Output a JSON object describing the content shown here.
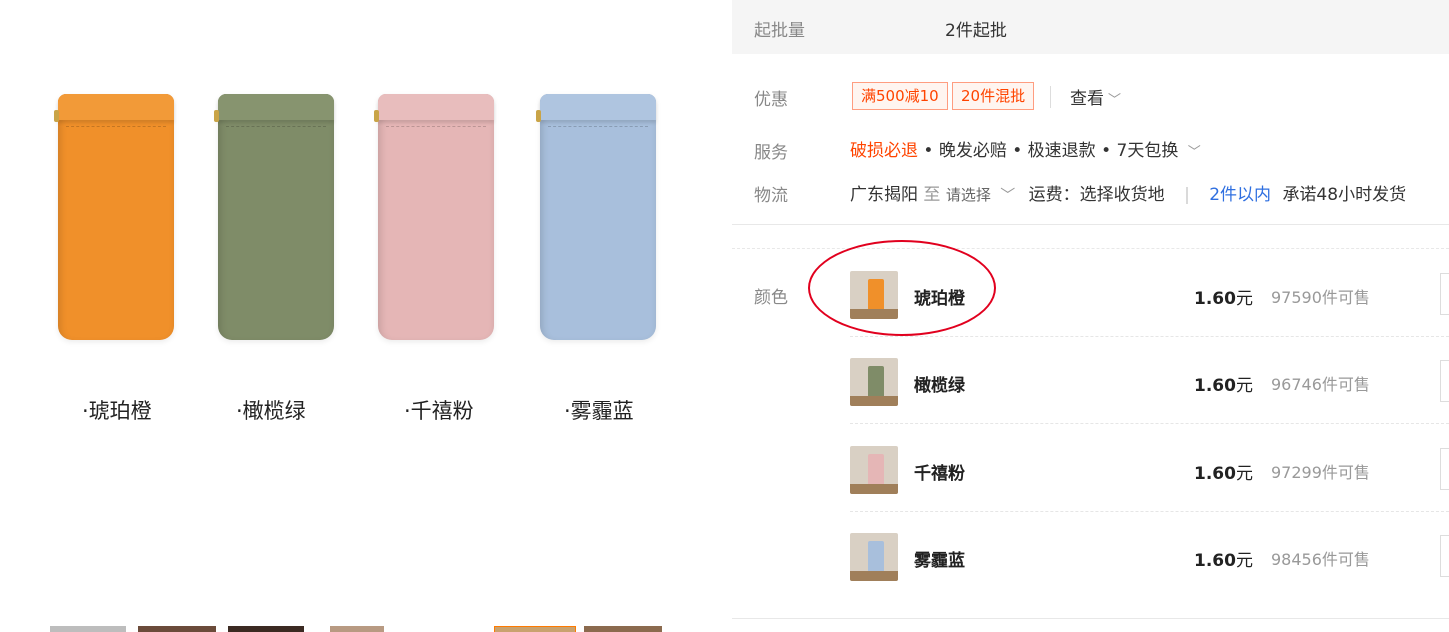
{
  "gallery": {
    "captions": [
      "·琥珀橙",
      "·橄榄绿",
      "·千禧粉",
      "·雾霾蓝"
    ],
    "pouch_colors": [
      "#f0902a",
      "#7f8c68",
      "#e5b6b6",
      "#a8bfdc"
    ]
  },
  "details": {
    "moq_label": "起批量",
    "moq_value": "2件起批",
    "promo_label": "优惠",
    "promo_tags": [
      "满500减10",
      "20件混批"
    ],
    "promo_see": "查看",
    "service_label": "服务",
    "service_highlight": "破损必退",
    "service_items": "• 晚发必赔 • 极速退款 • 7天包换",
    "logistics_label": "物流",
    "logistics_origin": "广东揭阳",
    "logistics_to": "至",
    "logistics_select": "请选择",
    "logistics_fee": "运费：选择收货地",
    "logistics_qty": "2件以内",
    "logistics_promise": "承诺48小时发货"
  },
  "sku": {
    "label": "颜色",
    "items": [
      {
        "name": "琥珀橙",
        "price": "1.60",
        "unit": "元",
        "stock": "97590件可售",
        "color": "#f0902a"
      },
      {
        "name": "橄榄绿",
        "price": "1.60",
        "unit": "元",
        "stock": "96746件可售",
        "color": "#7f8c68"
      },
      {
        "name": "千禧粉",
        "price": "1.60",
        "unit": "元",
        "stock": "97299件可售",
        "color": "#e5b6b6"
      },
      {
        "name": "雾霾蓝",
        "price": "1.60",
        "unit": "元",
        "stock": "98456件可售",
        "color": "#a8bfdc"
      }
    ]
  },
  "colors": {
    "accent": "#ff4400",
    "link": "#2f6fe0",
    "annotation": "#e1001e"
  }
}
